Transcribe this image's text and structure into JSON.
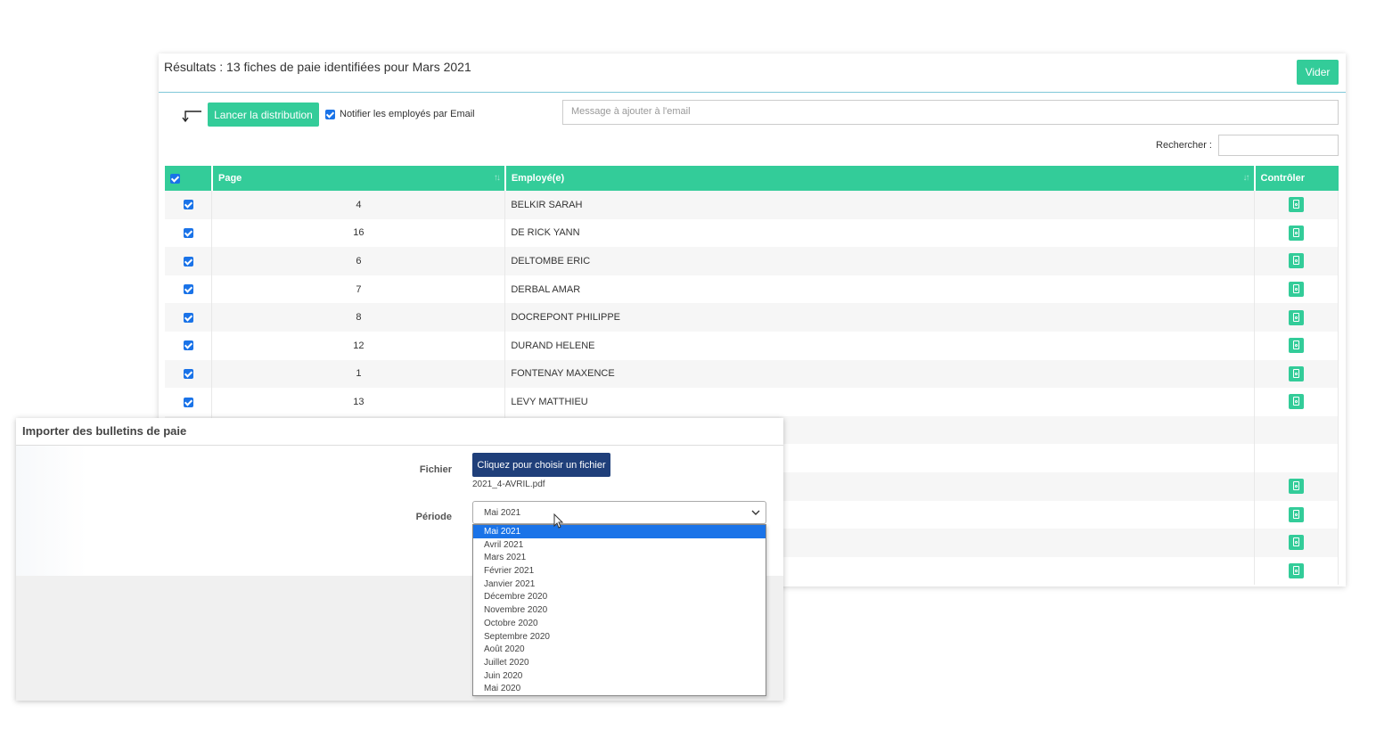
{
  "results": {
    "title": "Résultats : 13 fiches de paie identifiées pour Mars 2021",
    "clear_label": "Vider",
    "launch_label": "Lancer la distribution",
    "notify_label": "Notifier les employés par Email",
    "message_placeholder": "Message à ajouter à l'email",
    "search_label": "Rechercher :",
    "columns": {
      "page": "Page",
      "employee": "Employé(e)",
      "control": "Contrôler"
    },
    "rows": [
      {
        "page": "4",
        "employee": "BELKIR SARAH"
      },
      {
        "page": "16",
        "employee": "DE RICK YANN"
      },
      {
        "page": "6",
        "employee": "DELTOMBE ERIC"
      },
      {
        "page": "7",
        "employee": "DERBAL AMAR"
      },
      {
        "page": "8",
        "employee": "DOCREPONT PHILIPPE"
      },
      {
        "page": "12",
        "employee": "DURAND HELENE"
      },
      {
        "page": "1",
        "employee": "FONTENAY MAXENCE"
      },
      {
        "page": "13",
        "employee": "LEVY MATTHIEU"
      }
    ]
  },
  "import_modal": {
    "title": "Importer des bulletins de paie",
    "file_label": "Fichier",
    "choose_file_label": "Cliquez pour choisir un fichier",
    "file_name": "2021_4-AVRIL.pdf",
    "period_label": "Période",
    "period_selected": "Mai 2021",
    "period_options": [
      "Mai 2021",
      "Avril 2021",
      "Mars 2021",
      "Février 2021",
      "Janvier 2021",
      "Décembre 2020",
      "Novembre 2020",
      "Octobre 2020",
      "Septembre 2020",
      "Août 2020",
      "Juillet 2020",
      "Juin 2020",
      "Mai 2020"
    ]
  },
  "colors": {
    "accent": "#33cc99",
    "file_button": "#1f3f7a",
    "selected_option": "#1a73e8"
  },
  "icons": {
    "control": "pdf-file-icon",
    "sort": "sort-icon",
    "arrow": "return-arrow-icon",
    "cursor": "mouse-cursor-icon"
  }
}
